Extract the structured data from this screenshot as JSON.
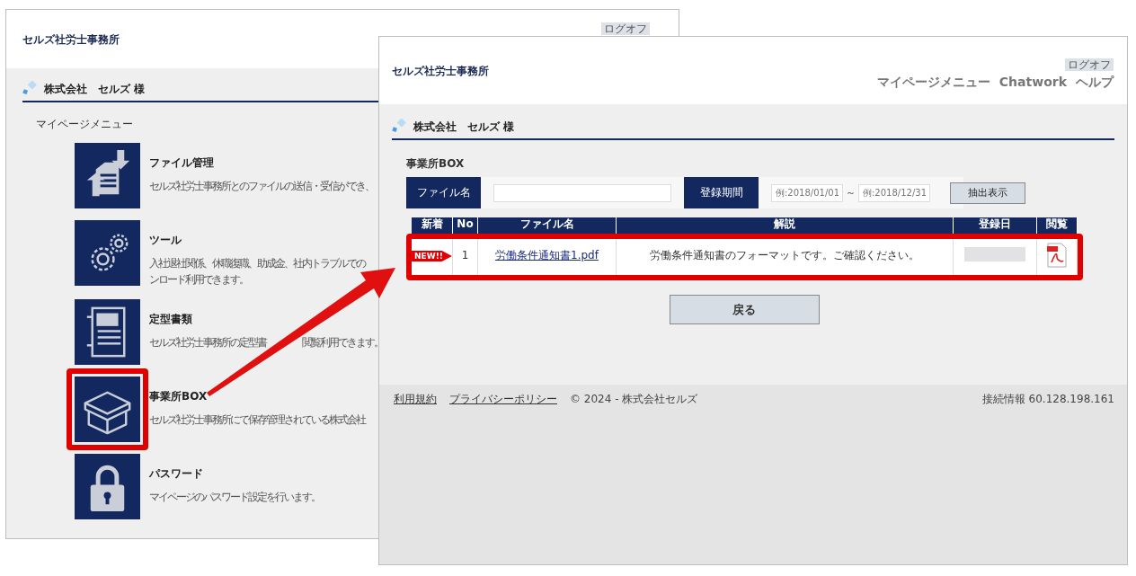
{
  "back_window": {
    "office": "セルズ社労士事務所",
    "logoff": "ログオフ",
    "customer": "株式会社　セルズ 様",
    "menu_heading": "マイページメニュー",
    "menu_items": [
      {
        "kind": "files",
        "title": "ファイル管理",
        "description": "セルズ社労士事務所とのファイルの送信・受信ができ、",
        "highlighted": false
      },
      {
        "kind": "tools",
        "title": "ツール",
        "description": "入社退社関係、休職復職、助成金、社内トラブルでの",
        "description_2": "ンロード利用できます。",
        "highlighted": false
      },
      {
        "kind": "forms",
        "title": "定型書類",
        "description": "セルズ社労士事務所の定型書",
        "description_after": "閲覧利用できます。",
        "highlighted": false
      },
      {
        "kind": "box",
        "title": "事業所BOX",
        "description": "セルズ社労士事務所にて保存管理されている株式会社",
        "highlighted": true
      },
      {
        "kind": "password",
        "title": "パスワード",
        "description": "マイページのパスワード設定を行います。",
        "highlighted": false
      }
    ]
  },
  "front_window": {
    "office": "セルズ社労士事務所",
    "logoff": "ログオフ",
    "nav": [
      "マイページメニュー",
      "Chatwork",
      "ヘルプ"
    ],
    "customer": "株式会社　セルズ 様",
    "section_title": "事業所BOX",
    "filter": {
      "file_label": "ファイル名",
      "period_label": "登録期間",
      "from_placeholder": "例:2018/01/01",
      "separator": "～",
      "to_placeholder": "例:2018/12/31",
      "button": "抽出表示"
    },
    "table": {
      "columns": [
        "新着",
        "No",
        "ファイル名",
        "解説",
        "登録日",
        "閲覧"
      ],
      "rows": [
        {
          "new": true,
          "new_badge": "NEW!!",
          "no": "1",
          "file": "労働条件通知書1.pdf",
          "description": "労働条件通知書のフォーマットです。ご確認ください。",
          "highlighted": true
        }
      ]
    },
    "back_button": "戻る",
    "footer": {
      "links": [
        "利用規約",
        "プライバシーポリシー"
      ],
      "copyright": "© 2024 - 株式会社セルズ",
      "connection": "接続情報 60.128.198.161"
    }
  }
}
